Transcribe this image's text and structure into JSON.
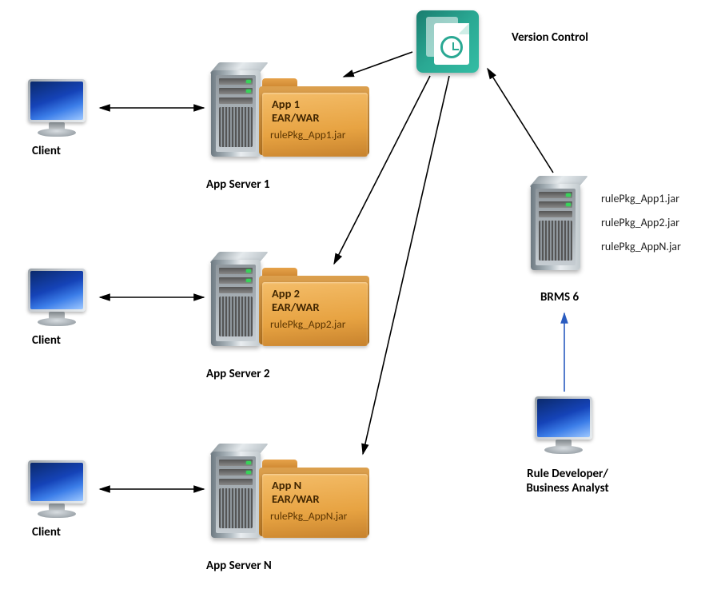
{
  "versionControl": {
    "label": "Version Control"
  },
  "clients": [
    {
      "label": "Client"
    },
    {
      "label": "Client"
    },
    {
      "label": "Client"
    }
  ],
  "appServers": [
    {
      "serverLabel": "App Server 1",
      "folderTitle1": "App 1",
      "folderTitle2": "EAR/WAR",
      "folderFile": "rulePkg_App1.jar"
    },
    {
      "serverLabel": "App Server 2",
      "folderTitle1": "App 2",
      "folderTitle2": "EAR/WAR",
      "folderFile": "rulePkg_App2.jar"
    },
    {
      "serverLabel": "App Server N",
      "folderTitle1": "App N",
      "folderTitle2": "EAR/WAR",
      "folderFile": "rulePkg_AppN.jar"
    }
  ],
  "brms": {
    "label": "BRMS 6",
    "files": [
      "rulePkg_App1.jar",
      "rulePkg_App2.jar",
      "rulePkg_AppN.jar"
    ]
  },
  "ruleDeveloper": {
    "line1": "Rule Developer/",
    "line2": "Business Analyst"
  }
}
